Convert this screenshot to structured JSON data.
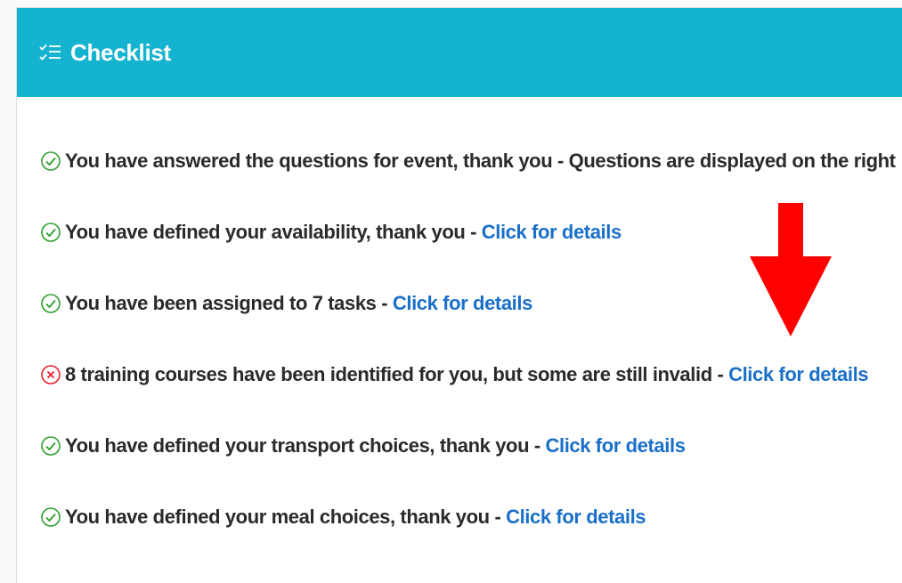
{
  "header": {
    "title": "Checklist",
    "icon": "checklist-icon",
    "background": "#14b3cf"
  },
  "colors": {
    "ok": "#2e9e2e",
    "error": "#e8202a",
    "link": "#1a6fc9",
    "arrow": "#ff0000"
  },
  "items": [
    {
      "status": "ok",
      "icon": "check-circle-icon",
      "text": "You have answered the questions for event, thank you",
      "suffix": "Questions are displayed on the right"
    },
    {
      "status": "ok",
      "icon": "check-circle-icon",
      "text": "You have defined your availability, thank you",
      "link": "Click for details"
    },
    {
      "status": "ok",
      "icon": "check-circle-icon",
      "text": "You have been assigned to 7 tasks",
      "link": "Click for details"
    },
    {
      "status": "error",
      "icon": "x-circle-icon",
      "text": "8 training courses have been identified for you, but some are still invalid",
      "link": "Click for details"
    },
    {
      "status": "ok",
      "icon": "check-circle-icon",
      "text": "You have defined your transport choices, thank you",
      "link": "Click for details"
    },
    {
      "status": "ok",
      "icon": "check-circle-icon",
      "text": "You have defined your meal choices, thank you",
      "link": "Click for details"
    }
  ],
  "separator": " - "
}
